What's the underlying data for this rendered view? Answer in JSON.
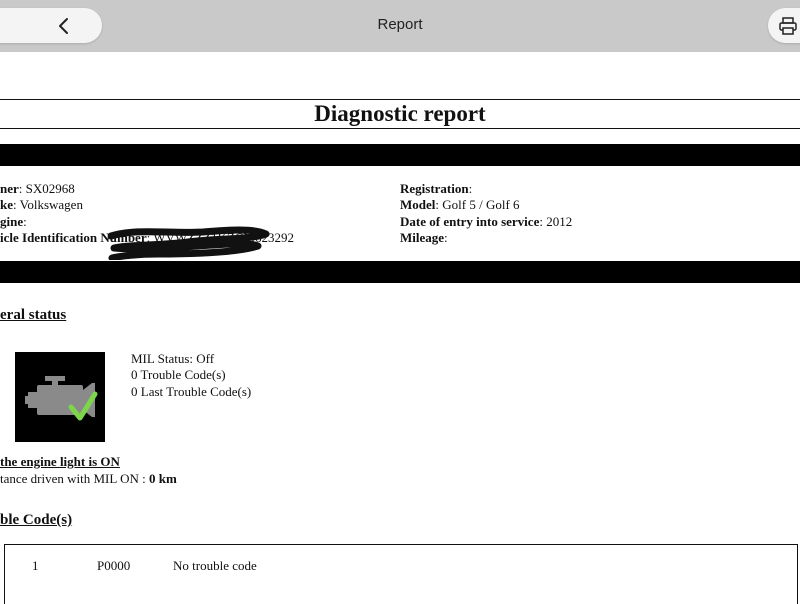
{
  "nav": {
    "title": "Report"
  },
  "document": {
    "title": "Diagnostic report"
  },
  "vehicle_info": {
    "left": [
      {
        "label": "ner",
        "value": ": SX02968"
      },
      {
        "label": "ke",
        "value": ": Volkswagen"
      },
      {
        "label": "gine",
        "value": ":"
      },
      {
        "label": "icle Identification Number",
        "value": ": WVWZZZ1KZCM623292"
      }
    ],
    "right": [
      {
        "label": "Registration",
        "value": ":"
      },
      {
        "label": "Model",
        "value": ": Golf 5 / Golf 6"
      },
      {
        "label": "Date of entry into service",
        "value": ": 2012"
      },
      {
        "label": "Mileage",
        "value": ":"
      }
    ]
  },
  "general_status": {
    "heading": "eral status",
    "mil_status": "MIL Status: Off",
    "trouble_codes": "0 Trouble Code(s)",
    "last_trouble_codes": "0 Last Trouble Code(s)",
    "engine_light_heading": "the engine light is ON",
    "distance_label": "tance driven with MIL ON : ",
    "distance_value": "0 km"
  },
  "trouble_codes": {
    "heading": "ble Code(s)",
    "rows": [
      {
        "index": "1",
        "code": "P0000",
        "description": "No trouble code"
      }
    ]
  },
  "colors": {
    "nav_bar": "#c9c9c9",
    "pill": "#f4f4f4",
    "band": "#000000",
    "check": "#7dd64a",
    "engine_icon": "#8a8a8a"
  }
}
